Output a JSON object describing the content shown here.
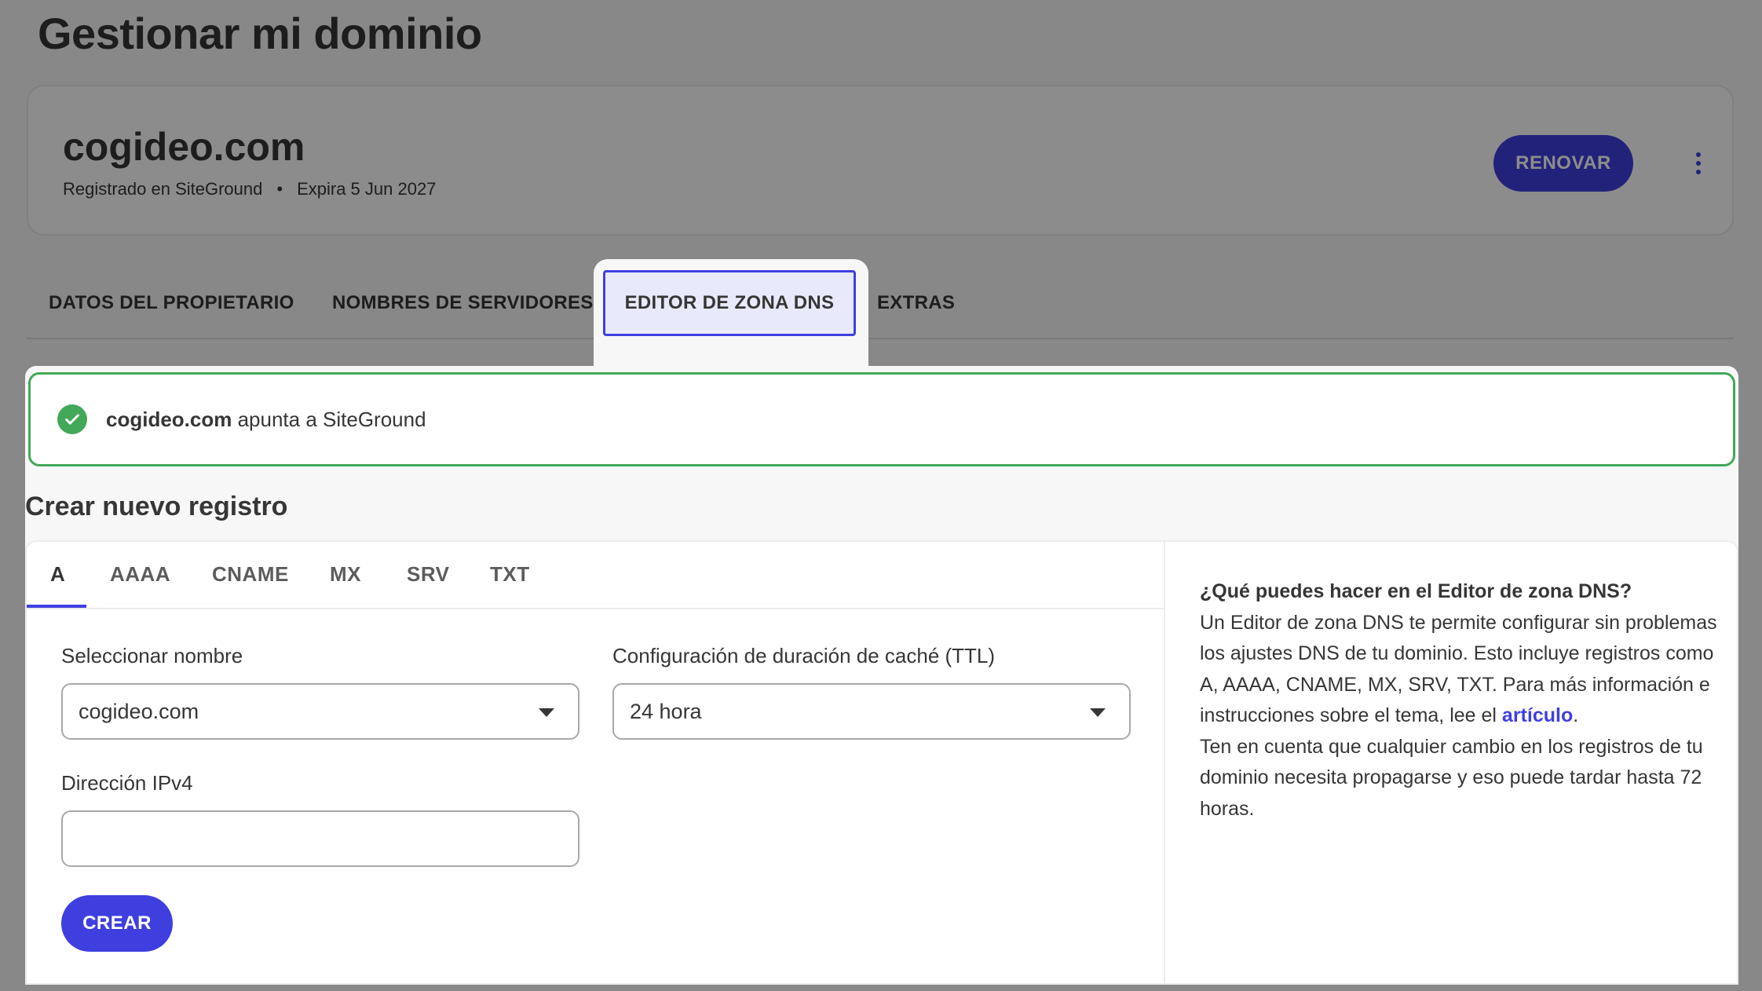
{
  "page": {
    "title": "Gestionar mi dominio"
  },
  "domain": {
    "name": "cogideo.com",
    "registered": "Registrado en SiteGround",
    "separator": "•",
    "expires": "Expira 5 Jun 2027",
    "renew_label": "RENOVAR"
  },
  "tabs": [
    {
      "label": "DATOS DEL PROPIETARIO"
    },
    {
      "label": "NOMBRES DE SERVIDORES"
    },
    {
      "label": "EDITOR DE ZONA DNS",
      "active": true
    },
    {
      "label": "EXTRAS"
    }
  ],
  "alert": {
    "domain": "cogideo.com",
    "text": "apunta a SiteGround",
    "icon": "check-circle-icon",
    "color": "#43a85a"
  },
  "create": {
    "title": "Crear nuevo registro",
    "record_tabs": [
      "A",
      "AAAA",
      "CNAME",
      "MX",
      "SRV",
      "TXT"
    ],
    "active_record_tab": "A",
    "name_label": "Seleccionar nombre",
    "name_value": "cogideo.com",
    "ttl_label": "Configuración de duración de caché (TTL)",
    "ttl_value": "24 hora",
    "ipv4_label": "Dirección IPv4",
    "ipv4_value": "",
    "submit_label": "CREAR"
  },
  "help": {
    "title": "¿Qué puedes hacer en el Editor de zona DNS?",
    "body_1": "Un Editor de zona DNS te permite configurar sin problemas los ajustes DNS de tu dominio. Esto incluye registros como A, AAAA, CNAME, MX, SRV, TXT. Para más información e instrucciones sobre el tema, lee el ",
    "link": "artículo",
    "body_1_end": ".",
    "body_2": "Ten en cuenta que cualquier cambio en los registros de tu dominio necesita propagarse y eso puede tardar hasta 72 horas."
  },
  "colors": {
    "accent": "#3f3fe0",
    "success": "#43a85a"
  }
}
